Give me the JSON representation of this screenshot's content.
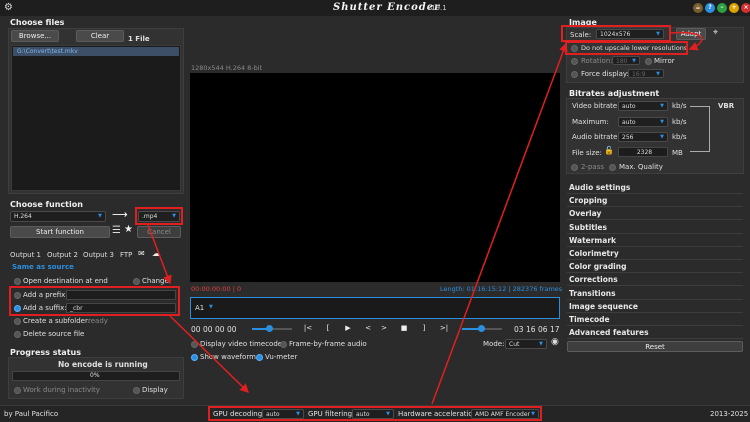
{
  "window": {
    "title": "Shutter Encoder",
    "version": "v19.1"
  },
  "files": {
    "header": "Choose files",
    "browse": "Browse...",
    "clear": "Clear",
    "count": "1 File",
    "items": [
      "G:\\Convert\\test.mkv"
    ]
  },
  "function": {
    "header": "Choose function",
    "codec": "H.264",
    "container": ".mp4",
    "start": "Start function",
    "cancel": "Cancel"
  },
  "output": {
    "tabs": [
      "Output 1",
      "Output 2",
      "Output 3",
      "FTP"
    ],
    "same_as_source": "Same as source",
    "open_destination": "Open destination at end",
    "change": "Change",
    "add_prefix": "Add a prefix:",
    "add_suffix": "Add a suffix:",
    "suffix_value": "_cbr",
    "create_subfolder": "Create a subfolder:",
    "subfolder_placeholder": "ready",
    "delete_source": "Delete source file"
  },
  "progress": {
    "header": "Progress status",
    "status": "No encode is running",
    "percent": "0%",
    "fraction": 0,
    "work_inactivity": "Work during inactivity",
    "display": "Display"
  },
  "preview": {
    "info": "1280x544 H.264 8-bit",
    "time_in": "00:00:00:00 | 0",
    "length": "Length: 01:16:15:12 | 282376 frames",
    "track": "A1",
    "tc_start": [
      "00",
      "00",
      "00",
      "00"
    ],
    "tc_end": [
      "03",
      "16",
      "06",
      "17"
    ],
    "buttons": [
      "|<",
      "[",
      "▶",
      "<",
      ">",
      "■",
      "]",
      ">|"
    ],
    "display_timecode": "Display video timecode",
    "frame_by_frame": "Frame-by-frame audio",
    "show_waveform": "Show waveform",
    "vu_meter": "Vu-meter",
    "mode_label": "Mode:",
    "mode_value": "Cut"
  },
  "image": {
    "header": "Image",
    "scale_label": "Scale:",
    "scale_value": "1024x576",
    "adapt": "Adapt",
    "no_upscale": "Do not upscale lower resolutions",
    "rotation_label": "Rotation:",
    "rotation_value": "180",
    "mirror": "Mirror",
    "force_display": "Force display:",
    "force_value": "16:9"
  },
  "bitrates": {
    "header": "Bitrates adjustment",
    "video_label": "Video bitrate:",
    "video_value": "auto",
    "unit": "kb/s",
    "vbr": "VBR",
    "max_label": "Maximum:",
    "max_value": "auto",
    "audio_label": "Audio bitrate:",
    "audio_value": "256",
    "size_label": "File size:",
    "size_value": "2328",
    "size_unit": "MB",
    "twopass": "2-pass",
    "max_quality": "Max. Quality"
  },
  "sections": [
    "Audio settings",
    "Cropping",
    "Overlay",
    "Subtitles",
    "Watermark",
    "Colorimetry",
    "Color grading",
    "Corrections",
    "Transitions",
    "Image sequence",
    "Timecode",
    "Advanced features"
  ],
  "reset": "Reset",
  "bottom": {
    "author": "by Paul Pacifico",
    "gpu_decoding": "GPU decoding:",
    "gpu_decoding_value": "auto",
    "gpu_filtering": "GPU filtering:",
    "gpu_filtering_value": "auto",
    "hw_accel": "Hardware acceleration:",
    "hw_accel_value": "AMD AMF Encoder",
    "years": "2013-2025"
  },
  "colors": {
    "accent": "#2b8fe0",
    "highlight": "#e02020",
    "timecode_red": "#e04040"
  }
}
